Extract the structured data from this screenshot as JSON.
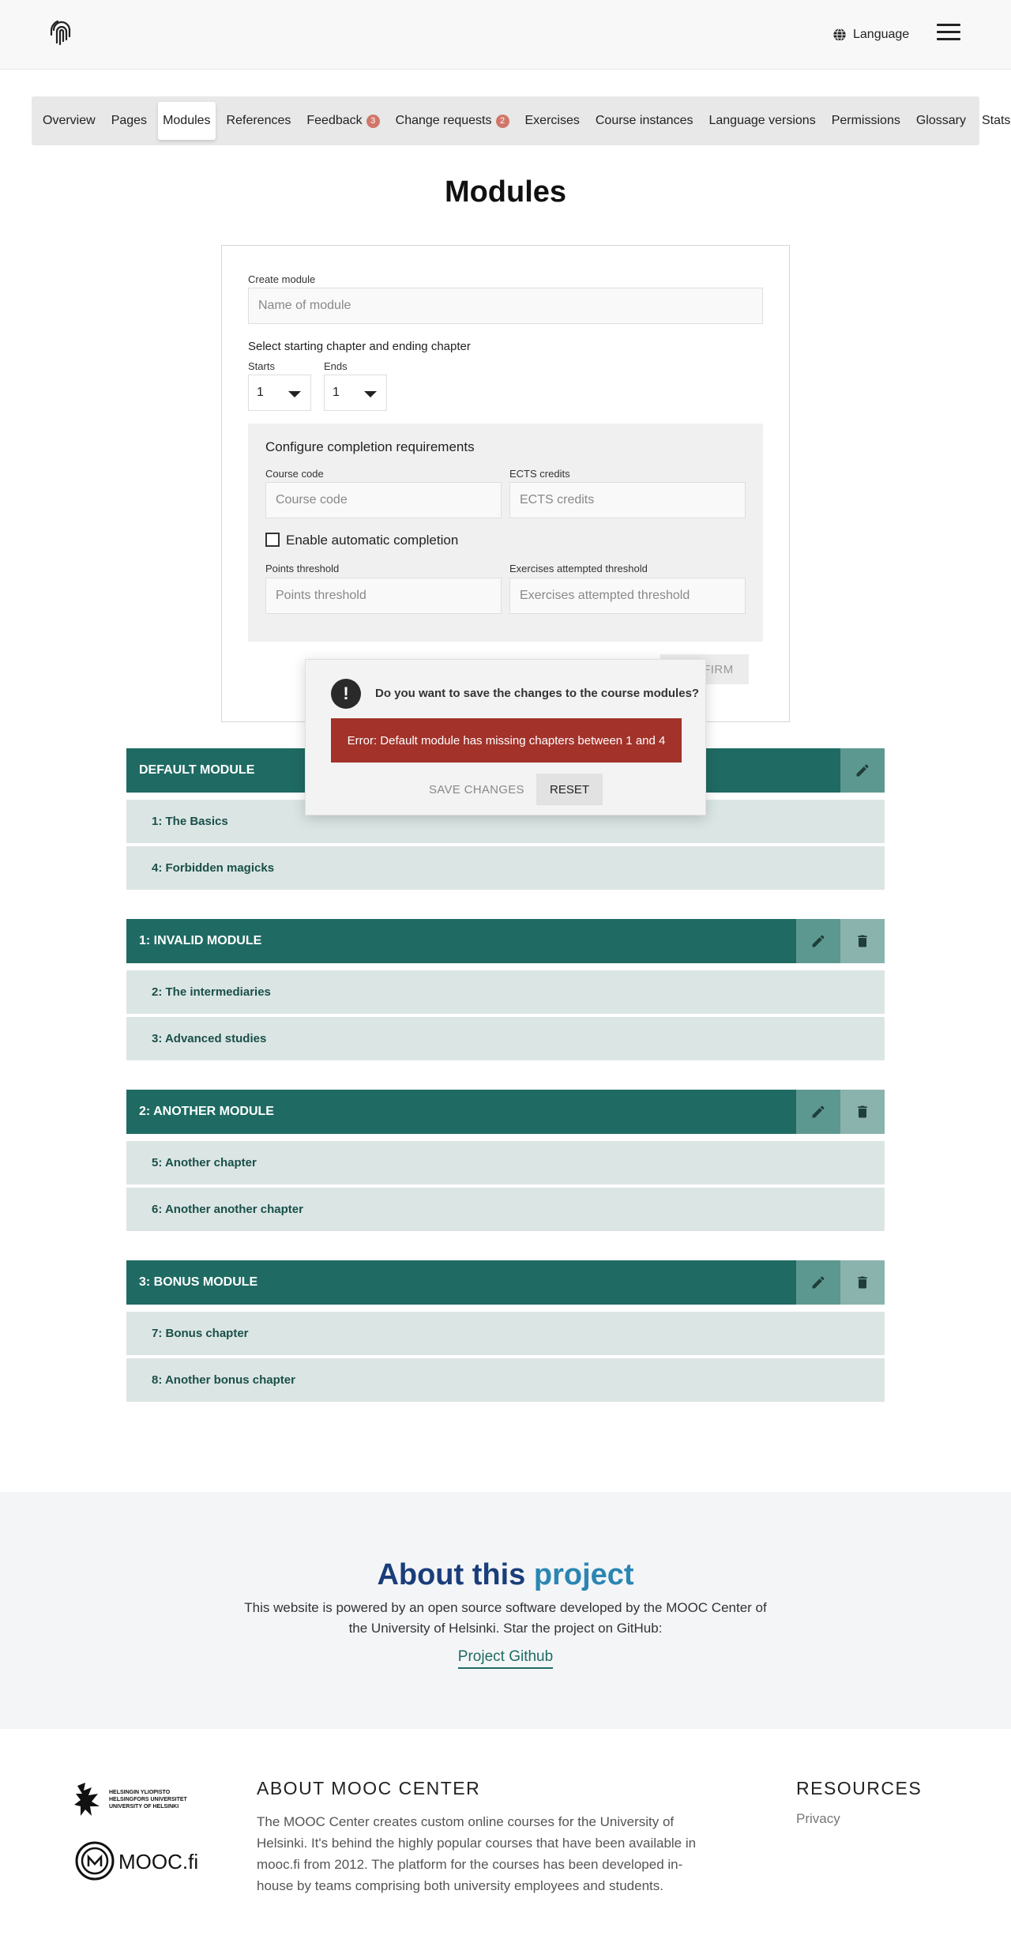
{
  "header": {
    "language_label": "Language"
  },
  "tabs": [
    {
      "label": "Overview"
    },
    {
      "label": "Pages"
    },
    {
      "label": "Modules",
      "active": true
    },
    {
      "label": "References"
    },
    {
      "label": "Feedback",
      "badge": "3"
    },
    {
      "label": "Change requests",
      "badge": "2"
    },
    {
      "label": "Exercises"
    },
    {
      "label": "Course instances"
    },
    {
      "label": "Language versions"
    },
    {
      "label": "Permissions"
    },
    {
      "label": "Glossary"
    },
    {
      "label": "Stats"
    }
  ],
  "page_title": "Modules",
  "create_form": {
    "create_label": "Create module",
    "name_placeholder": "Name of module",
    "select_heading": "Select starting chapter and ending chapter",
    "starts_label": "Starts",
    "starts_value": "1",
    "ends_label": "Ends",
    "ends_value": "1",
    "requirements_heading": "Configure completion requirements",
    "course_code_label": "Course code",
    "course_code_placeholder": "Course code",
    "ects_label": "ECTS credits",
    "ects_placeholder": "ECTS credits",
    "auto_completion_label": "Enable automatic completion",
    "points_label": "Points threshold",
    "points_placeholder": "Points threshold",
    "exercises_label": "Exercises attempted threshold",
    "exercises_placeholder": "Exercises attempted threshold",
    "confirm_label": "CONFIRM"
  },
  "modules": [
    {
      "title": "DEFAULT MODULE",
      "deletable": false,
      "chapters": [
        "1: The Basics",
        "4: Forbidden magicks"
      ]
    },
    {
      "title": "1: INVALID MODULE",
      "deletable": true,
      "chapters": [
        "2: The intermediaries",
        "3: Advanced studies"
      ]
    },
    {
      "title": "2: ANOTHER MODULE",
      "deletable": true,
      "chapters": [
        "5: Another chapter",
        "6: Another another chapter"
      ]
    },
    {
      "title": "3: BONUS MODULE",
      "deletable": true,
      "chapters": [
        "7: Bonus chapter",
        "8: Another bonus chapter"
      ]
    }
  ],
  "modal": {
    "icon": "!",
    "question": "Do you want to save the changes to the course modules?",
    "error": "Error: Default module has missing chapters between 1 and 4",
    "save_label": "SAVE CHANGES",
    "reset_label": "RESET"
  },
  "about": {
    "title_part1": "About this",
    "title_part2": "project",
    "text": "This website is powered by an open source software developed by the MOOC Center of the University of Helsinki. Star the project on GitHub:",
    "link": "Project Github"
  },
  "footer": {
    "about_heading": "ABOUT MOOC CENTER",
    "about_text": "The MOOC Center creates custom online courses for the University of Helsinki. It's behind the highly popular courses that have been available in mooc.fi from 2012. The platform for the courses has been developed in-house by teams comprising both university employees and students.",
    "resources_heading": "RESOURCES",
    "privacy_link": "Privacy",
    "logo_university_lines": [
      "HELSINGIN YLIOPISTO",
      "HELSINGFORS UNIVERSITET",
      "UNIVERSITY OF HELSINKI"
    ],
    "logo_mooc": "MOOC.fi"
  },
  "colors": {
    "module_header": "#1f6b63",
    "chapter_bg": "#dbe6e4",
    "error": "#a2322a",
    "badge": "#d0776a"
  }
}
